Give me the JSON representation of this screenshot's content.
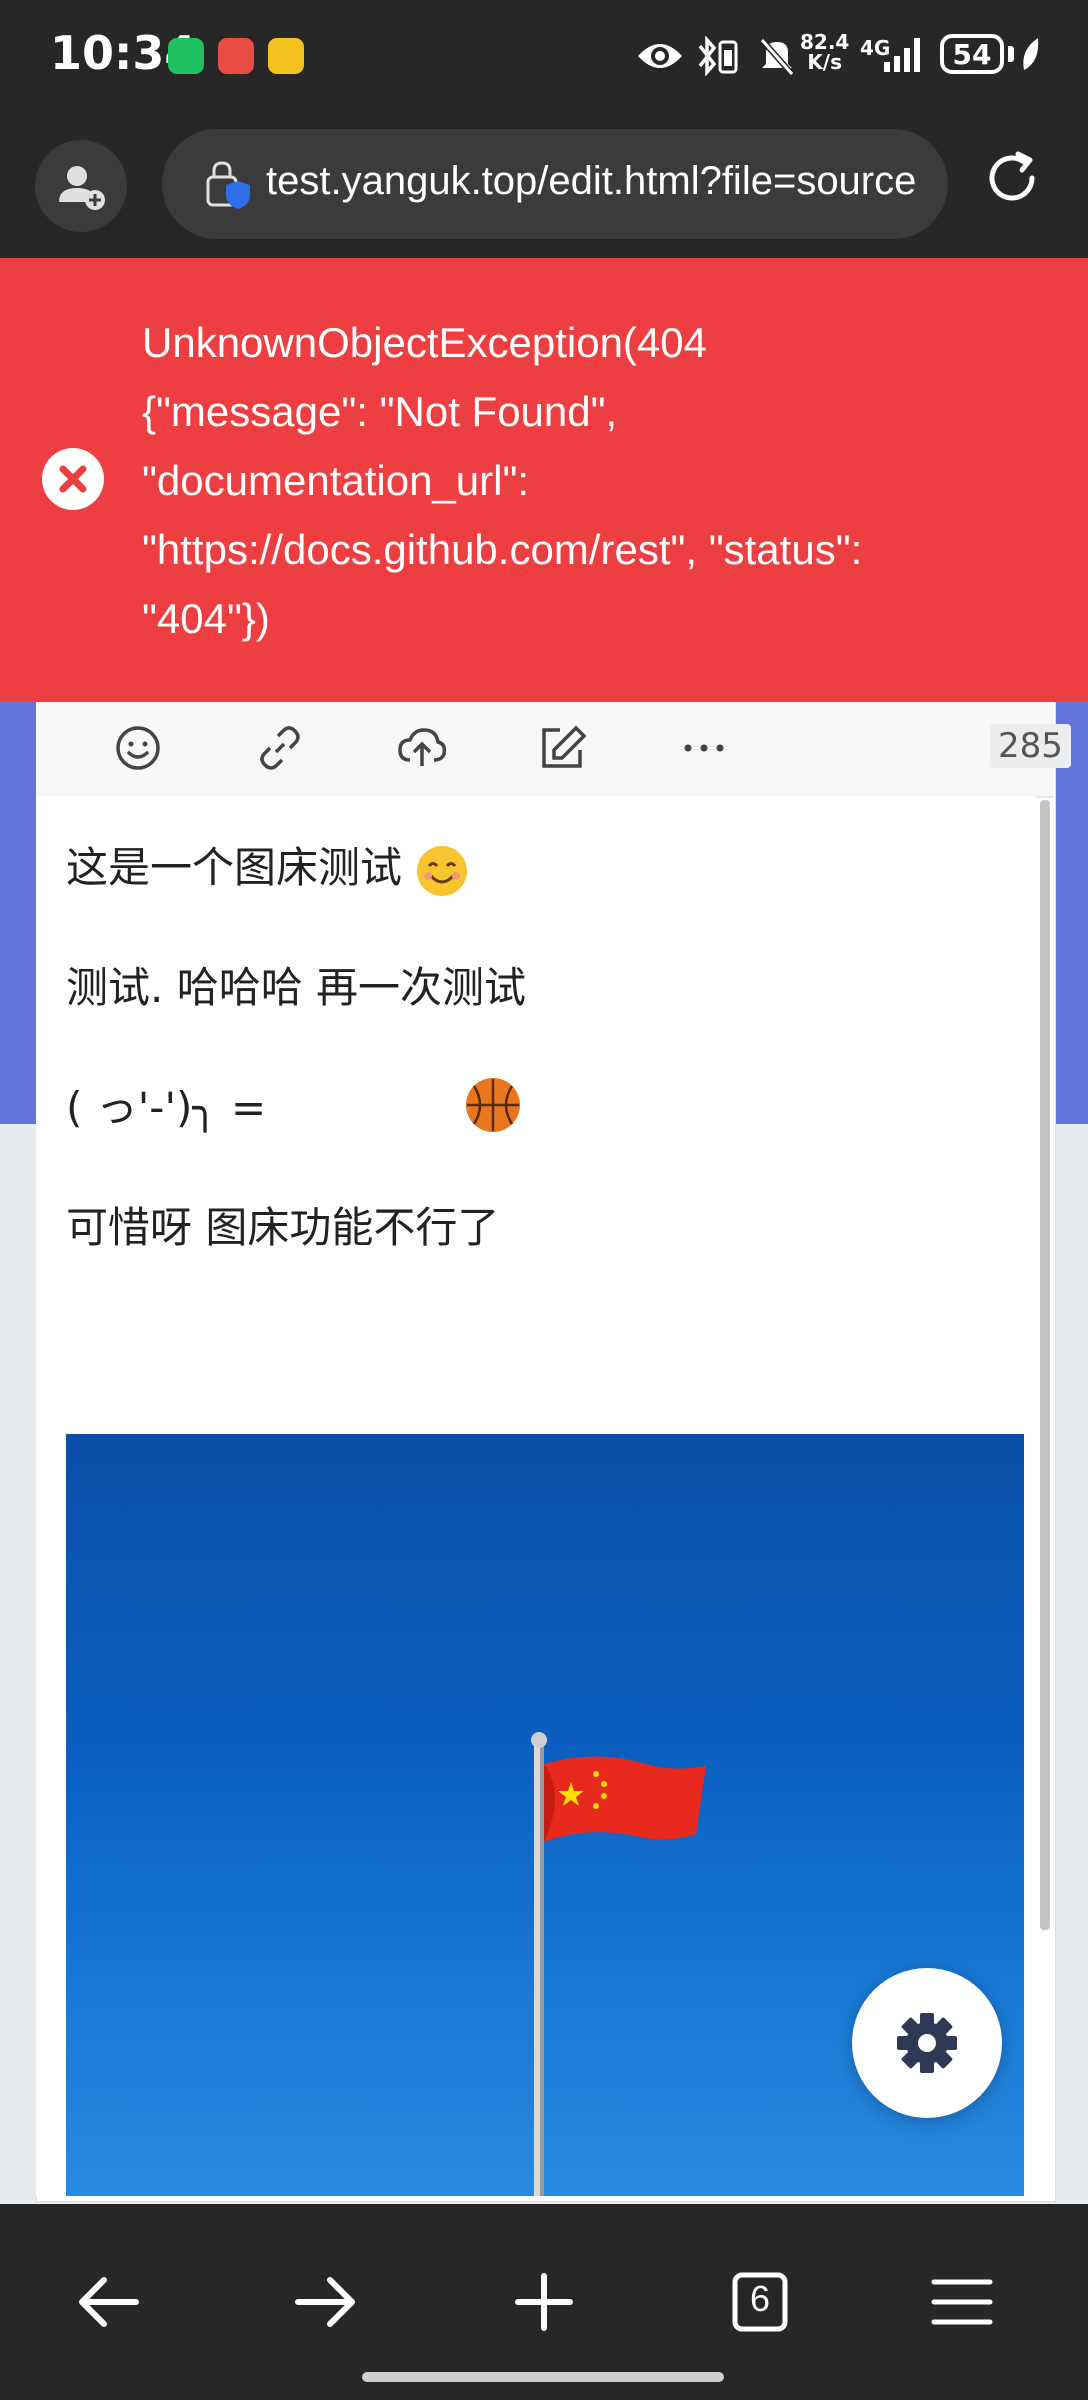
{
  "status_bar": {
    "time": "10:34",
    "net_speed_value": "82.4",
    "net_speed_unit": "K/s",
    "network": "4G",
    "battery": "54",
    "icons": [
      "wechat-icon",
      "shop-icon",
      "mail-icon",
      "eye-icon",
      "bluetooth-icon",
      "vibrate-icon",
      "mute-icon",
      "signal-icon",
      "battery-icon",
      "leaf-icon"
    ]
  },
  "browser": {
    "url": "test.yanguk.top/edit.html?file=source",
    "icons": [
      "profile-icon",
      "site-info-icon",
      "reload-icon"
    ]
  },
  "error": {
    "message": "UnknownObjectException(404\n{\"message\": \"Not Found\",\n\"documentation_url\":\n\"https://docs.github.com/rest\", \"status\":\n\"404\"})",
    "color": "#ed3f42"
  },
  "editor": {
    "toolbar_icons": [
      "emoji-icon",
      "link-icon",
      "upload-icon",
      "edit-icon",
      "more-icon"
    ],
    "char_count": "285",
    "lines": [
      "这是一个图床测试",
      "测试. 哈哈哈  再一次测试",
      "( っ'-')╮  =",
      "可惜呀  图床功能不行了"
    ]
  },
  "fab": {
    "icon": "gear-icon"
  },
  "bottom_nav": {
    "tab_count": "6",
    "icons": [
      "back-arrow-icon",
      "forward-arrow-icon",
      "new-tab-icon",
      "tabs-icon",
      "menu-icon"
    ]
  }
}
